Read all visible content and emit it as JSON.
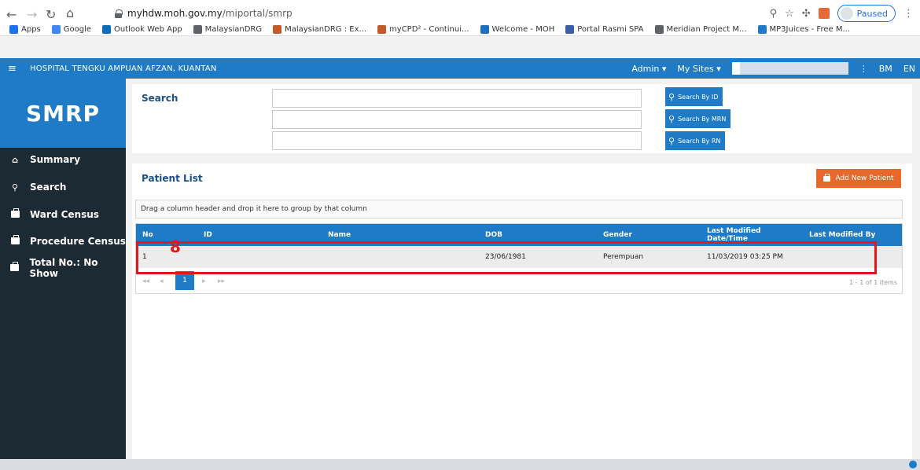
{
  "browser": {
    "url_host": "myhdw.moh.gov.my",
    "url_path": "/miportal/smrp",
    "profile_status": "Paused",
    "bookmarks": [
      {
        "label": "Apps",
        "color": "#1a73e8"
      },
      {
        "label": "Google",
        "color": "#4285f4"
      },
      {
        "label": "Outlook Web App",
        "color": "#0f6cbd"
      },
      {
        "label": "MalaysianDRG",
        "color": "#5f6368"
      },
      {
        "label": "MalaysianDRG : Ex...",
        "color": "#c25b2a"
      },
      {
        "label": "myCPD² - Continui...",
        "color": "#c25b2a"
      },
      {
        "label": "Welcome - MOH",
        "color": "#1f6fbf"
      },
      {
        "label": "Portal Rasmi SPA",
        "color": "#3a5fa8"
      },
      {
        "label": "Meridian Project M...",
        "color": "#5f6368"
      },
      {
        "label": "MP3Juices - Free M...",
        "color": "#1f7bc6"
      }
    ]
  },
  "appbar": {
    "hospital": "HOSPITAL TENGKU AMPUAN AFZAN, KUANTAN",
    "admin_label": "Admin ▾",
    "sites_label": "My Sites ▾",
    "lang_bm": "BM",
    "lang_en": "EN"
  },
  "sidebar": {
    "logo": "SMRP",
    "items": [
      {
        "label": "Summary",
        "icon": "home-icon"
      },
      {
        "label": "Search",
        "icon": "search-icon"
      },
      {
        "label": "Ward Census",
        "icon": "briefcase-icon"
      },
      {
        "label": "Procedure Census",
        "icon": "briefcase-icon"
      },
      {
        "label": "Total No.: No Show",
        "icon": "briefcase-icon"
      }
    ]
  },
  "search": {
    "title": "Search",
    "btn_id": "Search By ID",
    "btn_mrn": "Search By MRN",
    "btn_rn": "Search By RN"
  },
  "patient_list": {
    "title": "Patient List",
    "add_label": "Add New Patient",
    "group_hint": "Drag a column header and drop it here to group by that column",
    "annotation": "8",
    "columns": [
      "No",
      "ID",
      "Name",
      "DOB",
      "Gender",
      "Last Modified Date/Time",
      "Last Modified By"
    ],
    "rows": [
      {
        "no": "1",
        "id": "",
        "name": "",
        "dob": "23/06/1981",
        "gender": "Perempuan",
        "modified": "11/03/2019 03:25 PM",
        "modified_by": ""
      }
    ],
    "page": "1",
    "page_info": "1 - 1 of 1 items"
  },
  "colors": {
    "primary": "#1f7bc6",
    "sidebar": "#1c2a33",
    "add_button": "#e8672b",
    "highlight": "#e0191f"
  }
}
